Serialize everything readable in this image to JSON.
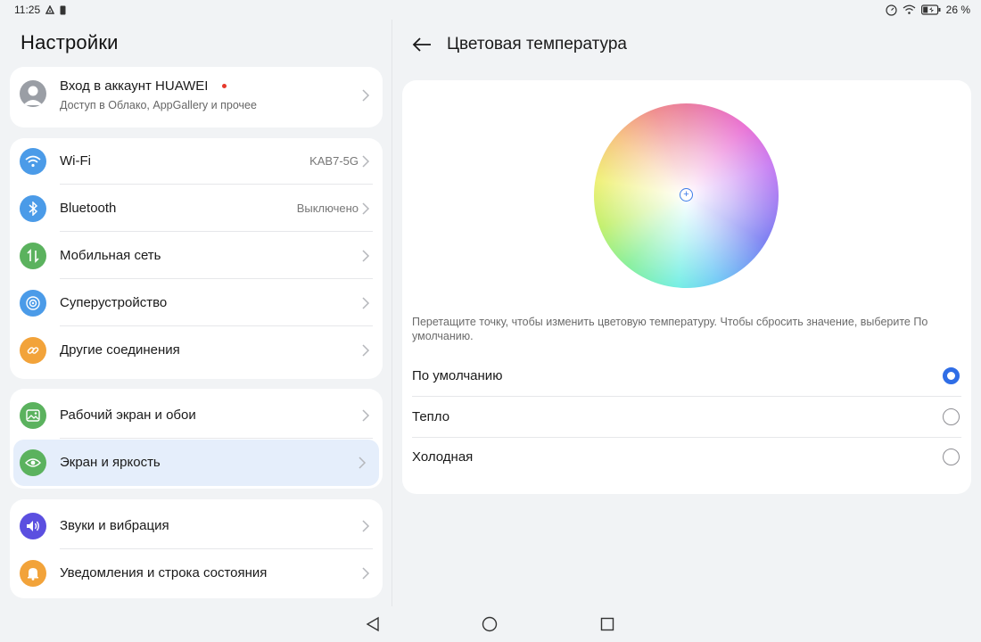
{
  "status": {
    "time": "11:25",
    "battery": "26 %"
  },
  "left": {
    "title": "Настройки",
    "account": {
      "title": "Вход в аккаунт HUAWEI",
      "subtitle": "Доступ в Облако, AppGallery и прочее"
    },
    "connections": [
      {
        "label": "Wi-Fi",
        "value": "KAB7-5G",
        "icon": "wifi-icon",
        "color": "#4b9be8"
      },
      {
        "label": "Bluetooth",
        "value": "Выключено",
        "icon": "bluetooth-icon",
        "color": "#4b9be8"
      },
      {
        "label": "Мобильная сеть",
        "value": "",
        "icon": "mobile-network-icon",
        "color": "#5bb25e"
      },
      {
        "label": "Суперустройство",
        "value": "",
        "icon": "super-device-icon",
        "color": "#4b9be8"
      },
      {
        "label": "Другие соединения",
        "value": "",
        "icon": "link-icon",
        "color": "#f2a33a"
      }
    ],
    "display": [
      {
        "label": "Рабочий экран и обои",
        "icon": "wallpaper-icon",
        "color": "#5bb25e"
      },
      {
        "label": "Экран и яркость",
        "icon": "eye-icon",
        "color": "#5bb25e"
      }
    ],
    "sound": [
      {
        "label": "Звуки и вибрация",
        "icon": "speaker-icon",
        "color": "#5b4fe0"
      },
      {
        "label": "Уведомления и строка состояния",
        "icon": "bell-icon",
        "color": "#f2a33a"
      }
    ]
  },
  "right": {
    "title": "Цветовая температура",
    "hint": "Перетащите точку, чтобы изменить цветовую температуру. Чтобы сбросить значение, выберите По умолчанию.",
    "options": [
      {
        "label": "По умолчанию",
        "checked": true
      },
      {
        "label": "Тепло",
        "checked": false
      },
      {
        "label": "Холодная",
        "checked": false
      }
    ],
    "accent": "#2f6de6"
  }
}
